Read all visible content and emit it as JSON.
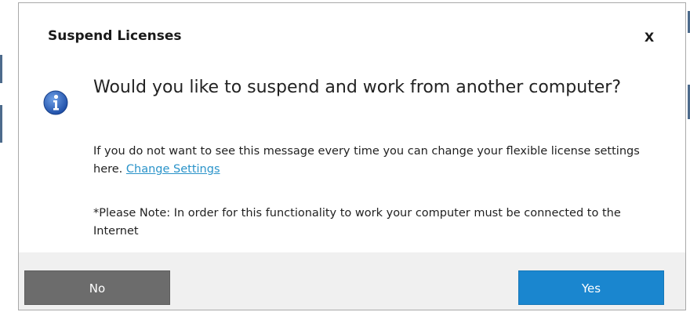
{
  "dialog": {
    "title": "Suspend Licenses",
    "close_label": "X",
    "question": "Would you like to suspend and work from another computer?",
    "message_text": "If you do not want to see this message every time you can change your flexible license settings here.",
    "change_settings_link": "Change Settings",
    "note": "*Please Note: In order for this functionality to work your computer must be connected to the Internet",
    "no_label": "No",
    "yes_label": "Yes"
  },
  "icons": {
    "info": "info-icon"
  },
  "colors": {
    "yes_button": "#1a86cf",
    "no_button": "#6c6c6c",
    "link": "#2a93c9",
    "footer": "#f0f0f0"
  }
}
